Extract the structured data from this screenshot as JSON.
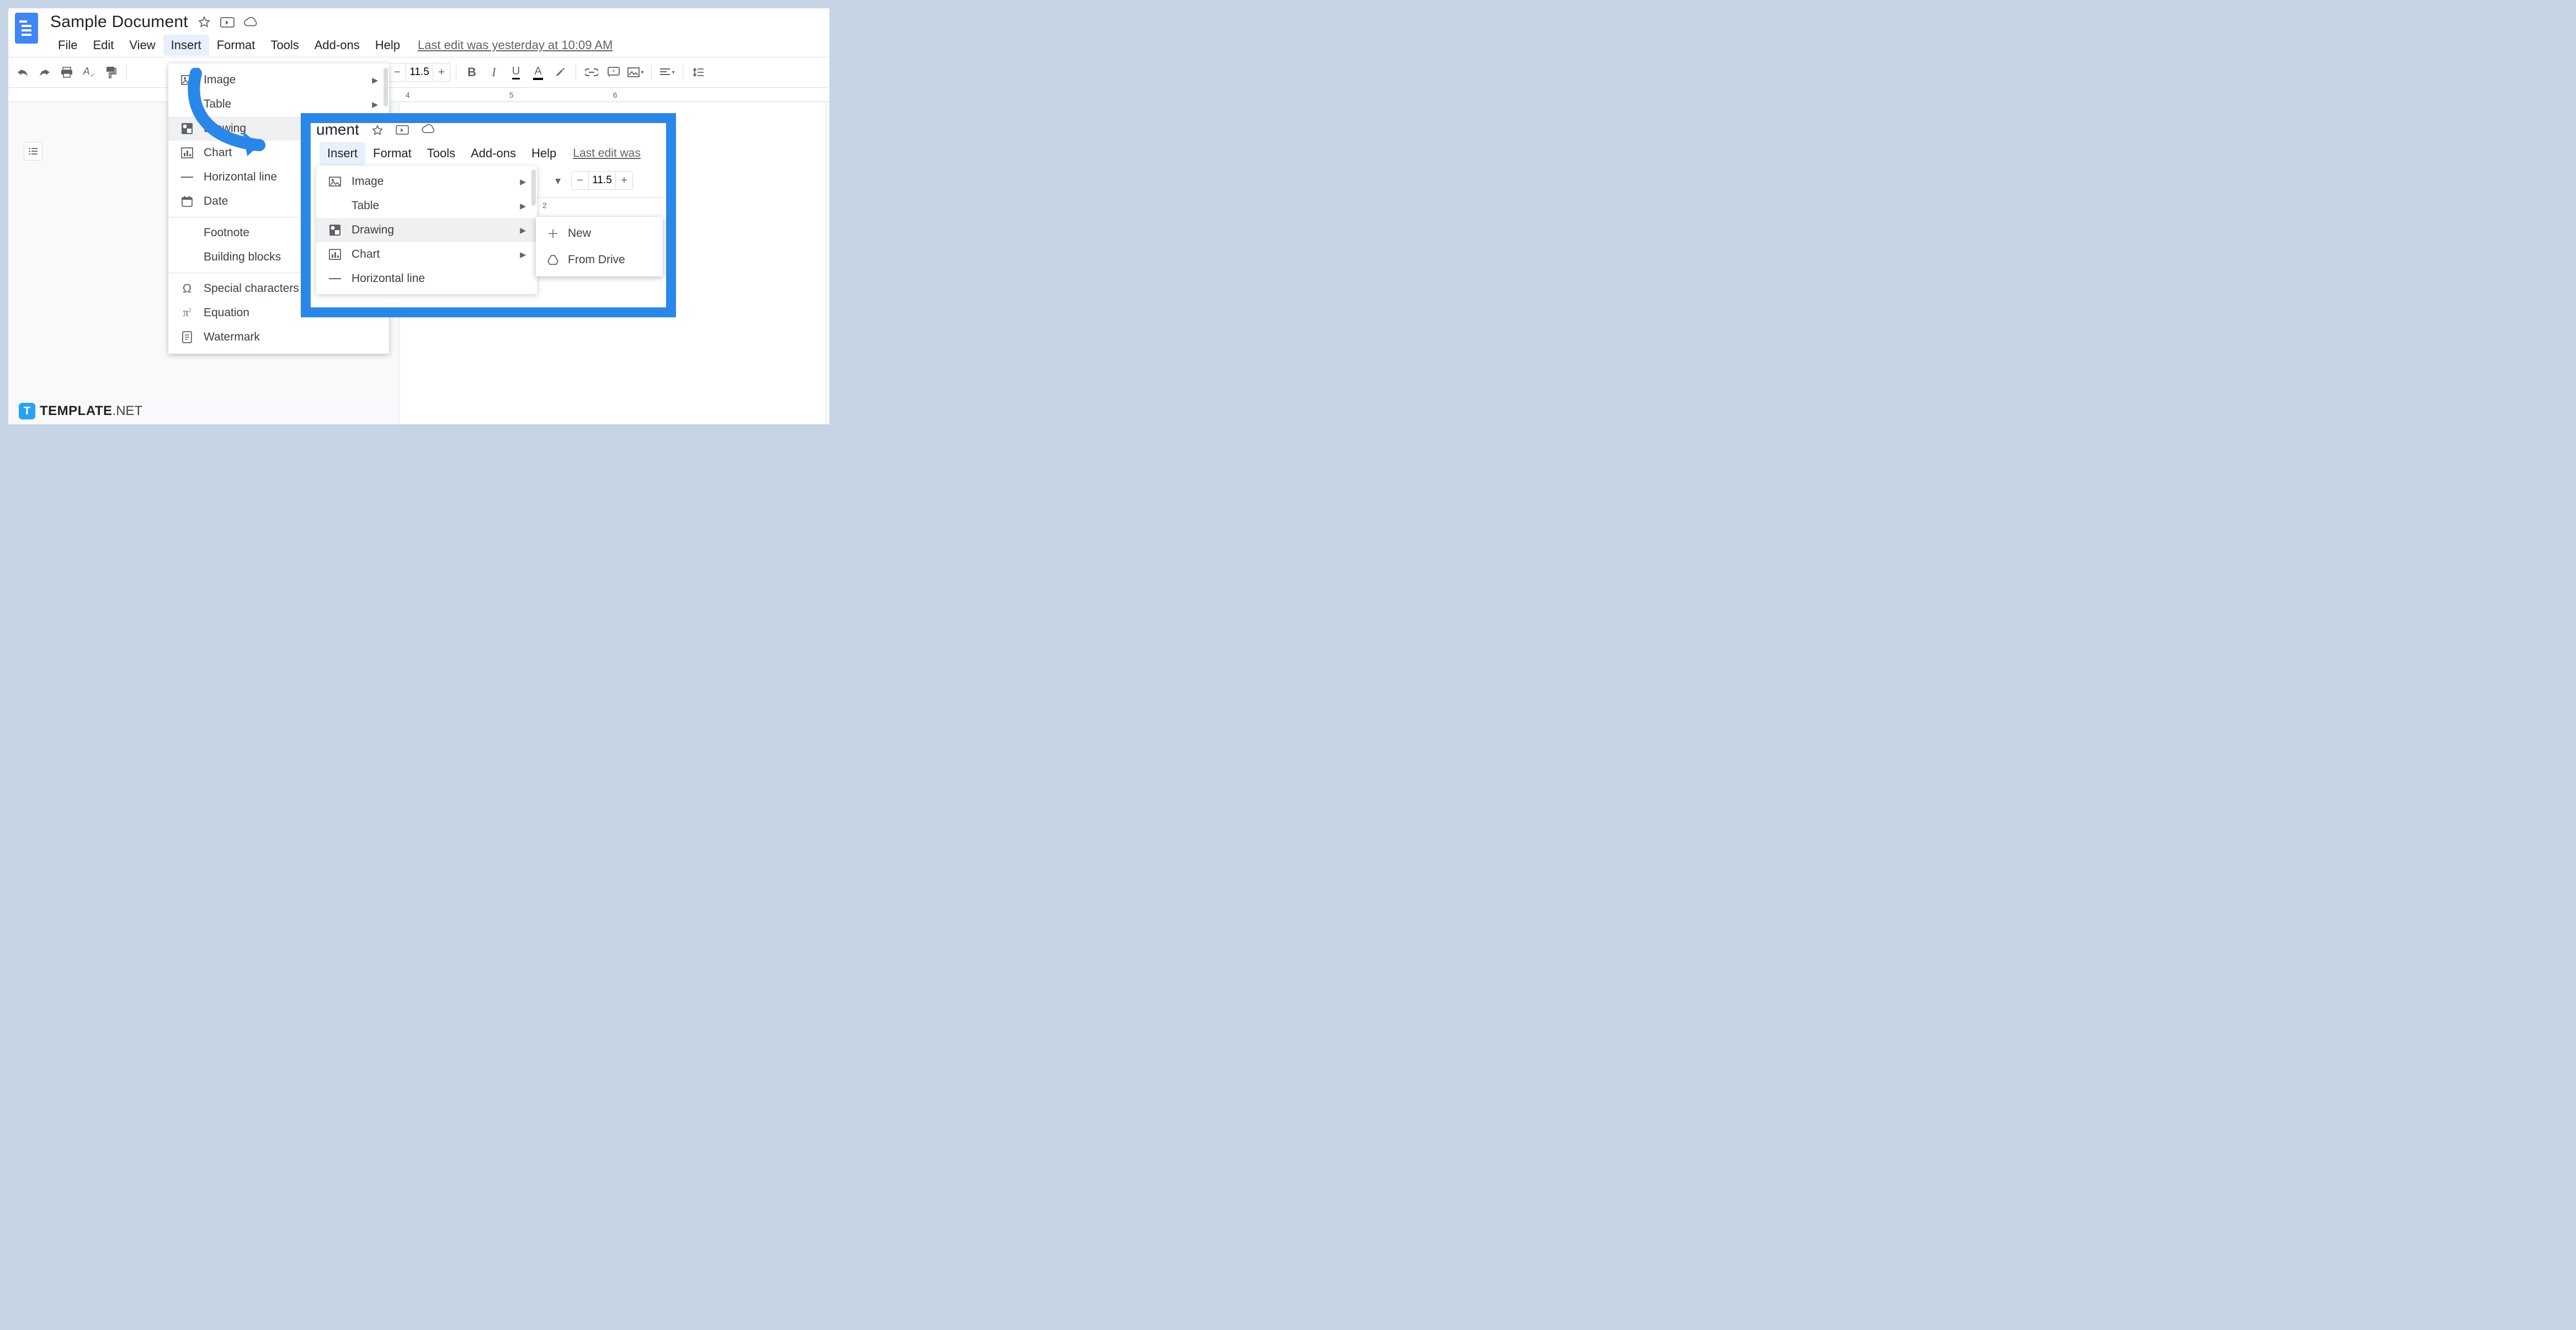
{
  "header": {
    "title": "Sample Document",
    "last_edit": "Last edit was yesterday at 10:09 AM"
  },
  "menubar": [
    "File",
    "Edit",
    "View",
    "Insert",
    "Format",
    "Tools",
    "Add-ons",
    "Help"
  ],
  "toolbar": {
    "font_size": "11.5"
  },
  "ruler": [
    "4",
    "5",
    "6"
  ],
  "insert_menu": {
    "items": [
      {
        "label": "Image",
        "icon": "image-icon",
        "submenu": true
      },
      {
        "label": "Table",
        "icon": "",
        "submenu": true
      },
      {
        "label": "Drawing",
        "icon": "drawing-icon",
        "submenu": true,
        "hover": true
      },
      {
        "label": "Chart",
        "icon": "chart-icon",
        "submenu": true
      },
      {
        "label": "Horizontal line",
        "icon": "hline-icon"
      },
      {
        "label": "Date",
        "icon": "date-icon"
      },
      {
        "label": "Footnote",
        "icon": ""
      },
      {
        "label": "Building blocks",
        "icon": ""
      },
      {
        "label": "Special characters",
        "icon": "omega-icon"
      },
      {
        "label": "Equation",
        "icon": "pi-icon"
      },
      {
        "label": "Watermark",
        "icon": "watermark-icon"
      }
    ],
    "separators_after": [
      5,
      7
    ]
  },
  "inset": {
    "title_fragment": "ument",
    "menubar": [
      "Insert",
      "Format",
      "Tools",
      "Add-ons",
      "Help"
    ],
    "last_edit_fragment": "Last edit was",
    "font_size": "11.5",
    "ruler": [
      "2"
    ],
    "insert_menu": [
      {
        "label": "Image",
        "icon": "image-icon",
        "submenu": true
      },
      {
        "label": "Table",
        "icon": "",
        "submenu": true
      },
      {
        "label": "Drawing",
        "icon": "drawing-icon",
        "submenu": true,
        "hover": true
      },
      {
        "label": "Chart",
        "icon": "chart-icon",
        "submenu": true
      },
      {
        "label": "Horizontal line",
        "icon": "hline-icon"
      }
    ],
    "submenu": [
      {
        "label": "New",
        "icon": "plus-icon"
      },
      {
        "label": "From Drive",
        "icon": "drive-icon"
      }
    ]
  },
  "watermark": {
    "bold": "TEMPLATE",
    "thin": ".NET"
  }
}
